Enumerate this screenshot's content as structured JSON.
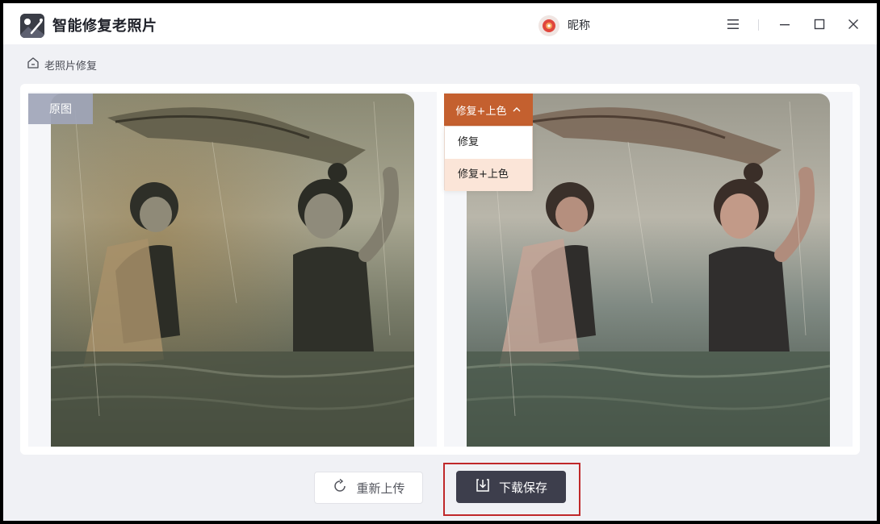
{
  "app": {
    "title": "智能修复老照片",
    "logo_icon": "magic-wand-photo-icon"
  },
  "user": {
    "nickname": "昵称",
    "avatar_icon": "avatar-icon",
    "avatar_color": "#e0463c"
  },
  "window_controls": {
    "menu_icon": "hamburger-menu-icon",
    "minimize_icon": "minimize-icon",
    "maximize_icon": "maximize-icon",
    "close_icon": "close-icon"
  },
  "breadcrumb": {
    "icon": "home-icon",
    "label": "老照片修复"
  },
  "original": {
    "badge": "原图"
  },
  "result": {
    "mode_selected": "修复+上色",
    "mode_options": [
      "修复",
      "修复+上色"
    ],
    "accent_color": "#c4602f"
  },
  "actions": {
    "reupload_label": "重新上传",
    "download_label": "下载保存"
  }
}
